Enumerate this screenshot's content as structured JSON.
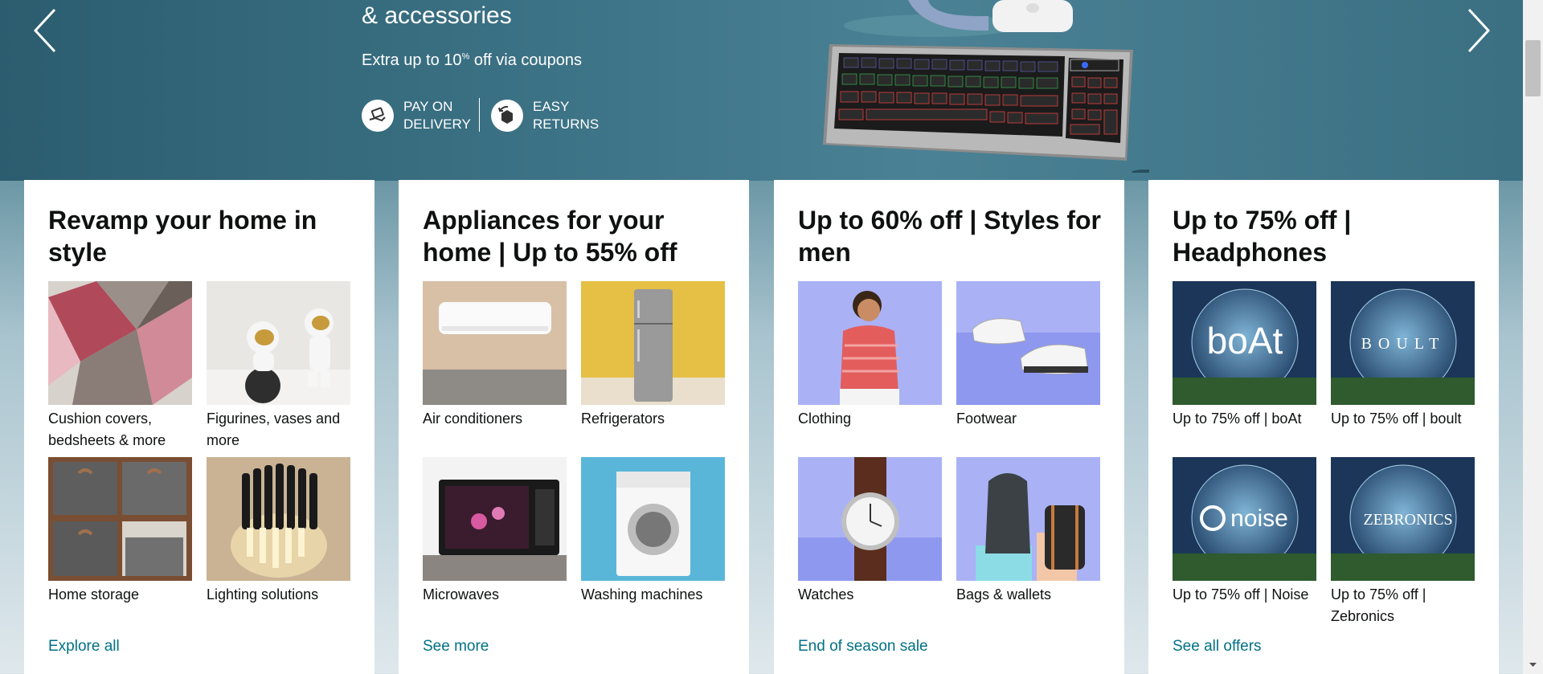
{
  "hero": {
    "title": "& accessories",
    "subtitle_prefix": "Extra up to 10",
    "subtitle_sup": "%",
    "subtitle_suffix": " off via coupons",
    "perks": [
      {
        "icon": "delivery-hand-icon",
        "label": "PAY ON\nDELIVERY"
      },
      {
        "icon": "returns-box-icon",
        "label": "EASY\nRETURNS"
      }
    ]
  },
  "cards": [
    {
      "title": "Revamp your home in style",
      "link": "Explore all",
      "tiles": [
        {
          "label": "Cushion covers, bedsheets & more",
          "icon": "rug-image"
        },
        {
          "label": "Figurines, vases and more",
          "icon": "astronaut-figurine-image"
        },
        {
          "label": "Home storage",
          "icon": "storage-shelf-image"
        },
        {
          "label": "Lighting solutions",
          "icon": "wall-lamp-image"
        }
      ]
    },
    {
      "title": "Appliances for your home | Up to 55% off",
      "link": "See more",
      "tiles": [
        {
          "label": "Air conditioners",
          "icon": "air-conditioner-image"
        },
        {
          "label": "Refrigerators",
          "icon": "refrigerator-image"
        },
        {
          "label": "Microwaves",
          "icon": "microwave-image"
        },
        {
          "label": "Washing machines",
          "icon": "washing-machine-image"
        }
      ]
    },
    {
      "title": "Up to 60% off | Styles for men",
      "link": "End of season sale",
      "tiles": [
        {
          "label": "Clothing",
          "icon": "man-clothing-image"
        },
        {
          "label": "Footwear",
          "icon": "sneakers-image"
        },
        {
          "label": "Watches",
          "icon": "wristwatch-image"
        },
        {
          "label": "Bags & wallets",
          "icon": "backpack-image"
        }
      ]
    },
    {
      "title": "Up to 75% off | Headphones",
      "link": "See all offers",
      "tiles": [
        {
          "label": "Up to 75% off | boAt",
          "brand": "boAt",
          "icon": "boat-logo-image"
        },
        {
          "label": "Up to 75% off | boult",
          "brand": "BOULT",
          "icon": "boult-logo-image"
        },
        {
          "label": "Up to 75% off | Noise",
          "brand": "noise",
          "icon": "noise-logo-image"
        },
        {
          "label": "Up to 75% off | Zebronics",
          "brand": "ZEBRONICS",
          "icon": "zebronics-logo-image"
        }
      ]
    }
  ],
  "colors": {
    "link": "#007185",
    "text": "#0f1111",
    "hero": "#3c7285"
  }
}
